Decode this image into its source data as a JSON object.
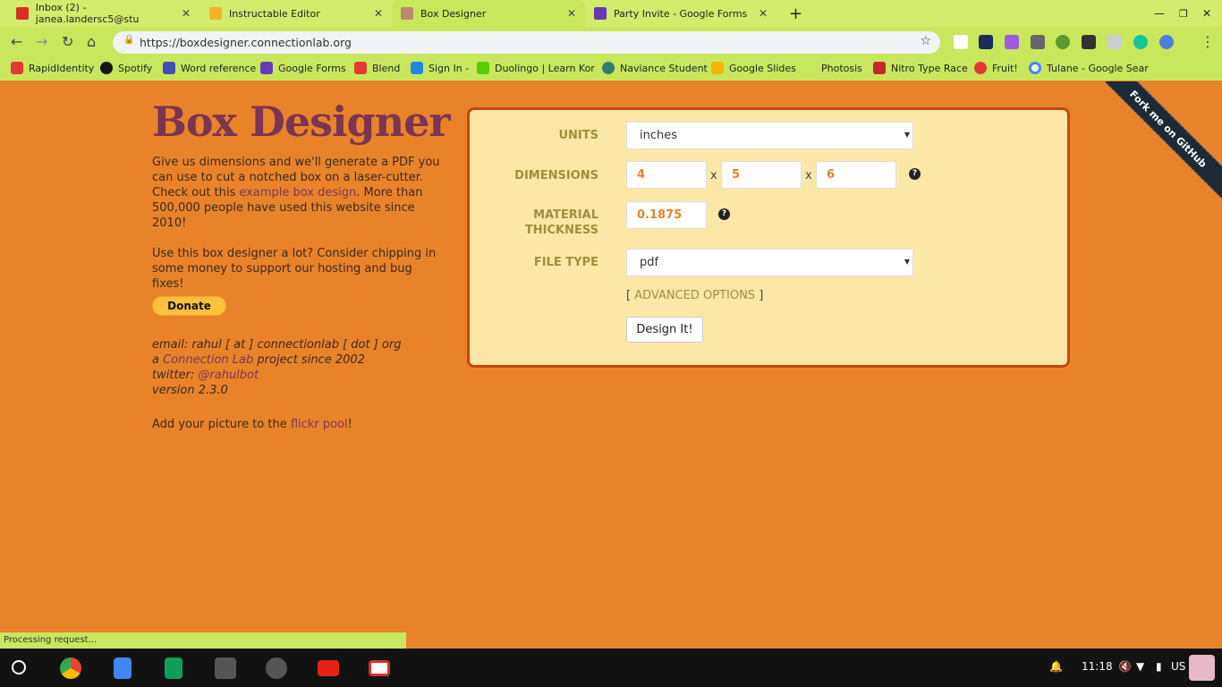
{
  "browser": {
    "tabs": [
      {
        "title": "Inbox (2) - janea.landersc5@stu",
        "icon": "gmail-icon",
        "color": "#d93025"
      },
      {
        "title": "Instructable Editor",
        "icon": "instructables-icon",
        "color": "#f0b429"
      },
      {
        "title": "Box Designer",
        "icon": "box-designer-icon",
        "color": "#b98b6e",
        "active": true
      },
      {
        "title": "Party Invite - Google Forms",
        "icon": "google-forms-icon",
        "color": "#673ab7"
      }
    ],
    "url": "https://boxdesigner.connectionlab.org",
    "bookmarks": [
      {
        "label": "RapidIdentity",
        "color": "#e53935"
      },
      {
        "label": "Spotify",
        "color": "#191414"
      },
      {
        "label": "Word reference",
        "color": "#3f51b5"
      },
      {
        "label": "Google Forms",
        "color": "#673ab7"
      },
      {
        "label": "Blend",
        "color": "#e53935"
      },
      {
        "label": "Sign In -",
        "color": "#1e88e5"
      },
      {
        "label": "Duolingo | Learn Kor",
        "color": "#58cc02"
      },
      {
        "label": "Naviance Student",
        "color": "#2e7d6f"
      },
      {
        "label": "Google Slides",
        "color": "#f4b400"
      },
      {
        "label": "Photosis",
        "color": "#c8e75c"
      },
      {
        "label": "Nitro Type Race",
        "color": "#c62828"
      },
      {
        "label": "Fruit!",
        "color": "#e53935"
      },
      {
        "label": "Tulane - Google Sear",
        "color": "#4285f4"
      }
    ],
    "status": "Processing request..."
  },
  "page": {
    "title": "Box Designer",
    "intro_1": "Give us dimensions and we'll generate a PDF you can use to cut a notched box on a laser-cutter. Check out this ",
    "intro_link": "example box design",
    "intro_2": ". More than 500,000 people have used this website since 2010!",
    "support": "Use this box designer a lot? Consider chipping in some money to support our hosting and bug fixes!",
    "donate": "Donate",
    "email": "email: rahul [ at ] connectionlab [ dot ] org",
    "project_pre": "a ",
    "project_link": "Connection Lab",
    "project_post": " project since 2002",
    "twitter_pre": "twitter: ",
    "twitter_link": "@rahulbot",
    "version": "version 2.3.0",
    "flickr_pre": "Add your picture to the ",
    "flickr_link": "flickr pool",
    "flickr_post": "!",
    "ribbon": "Fork me on GitHub"
  },
  "form": {
    "units_label": "UNITS",
    "units_value": "inches",
    "dimensions_label": "DIMENSIONS",
    "dim_w": "4",
    "dim_h": "5",
    "dim_d": "6",
    "times": "x",
    "thickness_label_1": "MATERIAL",
    "thickness_label_2": "THICKNESS",
    "thickness_value": "0.1875",
    "filetype_label": "FILE TYPE",
    "filetype_value": "pdf",
    "advanced": "ADVANCED OPTIONS",
    "bracket_l": "[",
    "bracket_r": "]",
    "submit": "Design It!",
    "help": "?"
  },
  "shelf": {
    "time": "11:18",
    "locale": "US"
  }
}
